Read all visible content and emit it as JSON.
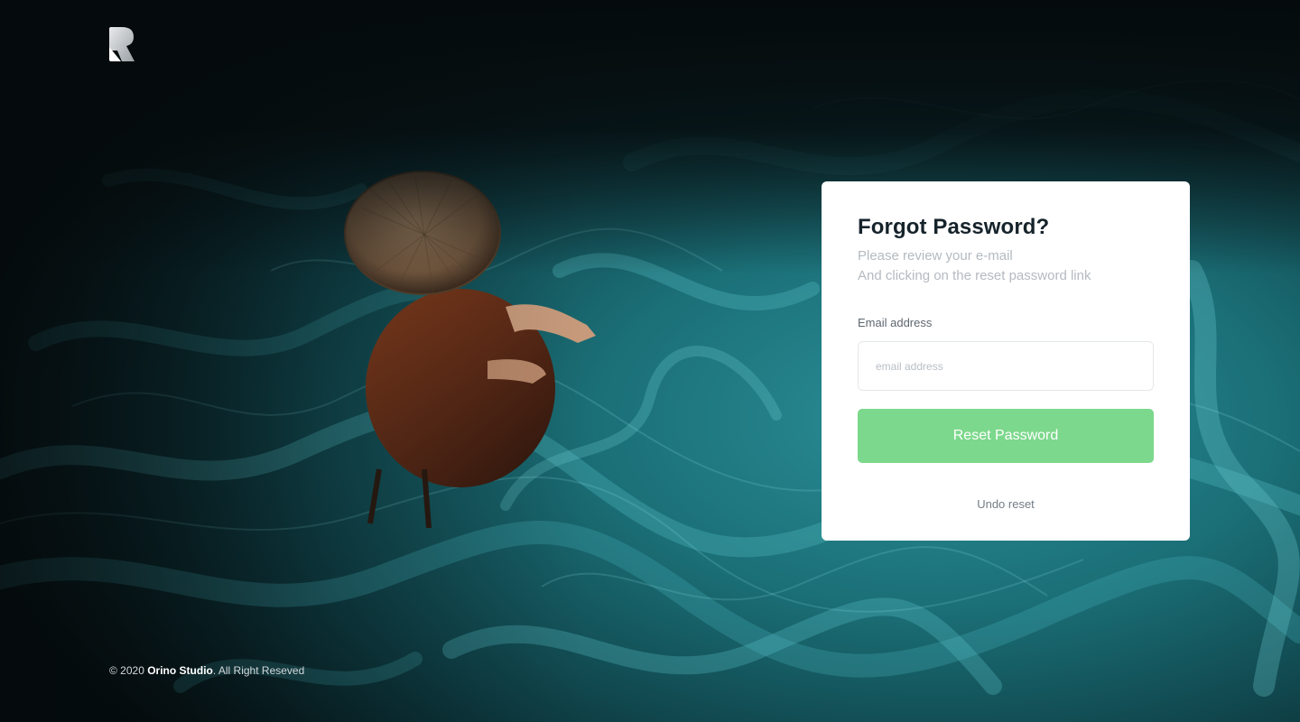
{
  "brand": {
    "logo_icon": "r-logo-icon"
  },
  "card": {
    "title": "Forgot Password?",
    "subtitle_line1": "Please review your e-mail",
    "subtitle_line2": "And clicking on the reset password link",
    "email_label": "Email address",
    "email_value": "",
    "email_placeholder": "email address",
    "reset_button_label": "Reset Password",
    "undo_link_label": "Undo reset"
  },
  "footer": {
    "copyright_prefix": "© 2020 ",
    "brand_name": "Orino Studio",
    "copyright_suffix": ". All Right Reseved"
  },
  "colors": {
    "accent_green": "#7cd88c",
    "title_dark": "#16232b",
    "background_teal": "#1a6f78"
  }
}
